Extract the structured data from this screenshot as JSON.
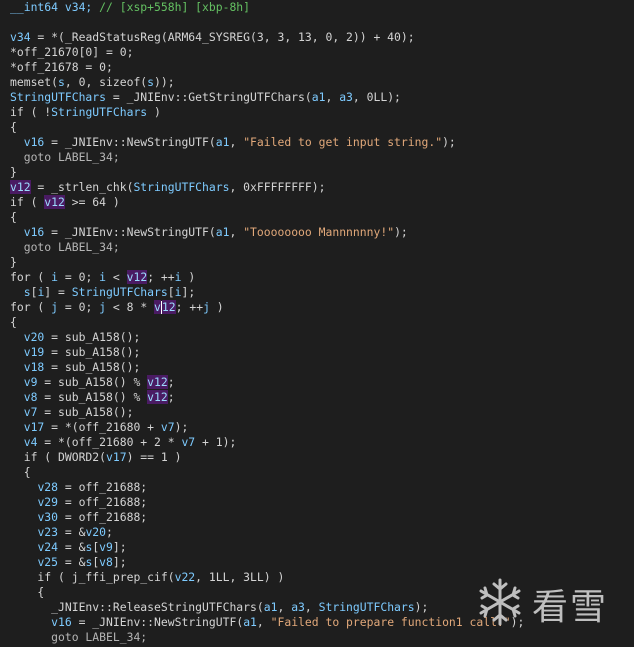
{
  "code_lines": [
    [
      {
        "t": "__int64 v34; ",
        "c": "var"
      },
      {
        "t": "// [xsp+558h] [xbp-8h]",
        "c": "cmt"
      }
    ],
    [],
    [
      {
        "t": "v34",
        "c": "var"
      },
      {
        "t": " = *(_ReadStatusReg(ARM64_SYSREG(3, 3, 13, 0, 2)) + 40);",
        "c": "white"
      }
    ],
    [
      {
        "t": "*off_21670[0] = 0;",
        "c": "white"
      }
    ],
    [
      {
        "t": "*off_21678 = 0;",
        "c": "white"
      }
    ],
    [
      {
        "t": "memset(",
        "c": "white"
      },
      {
        "t": "s",
        "c": "var"
      },
      {
        "t": ", 0, sizeof(",
        "c": "white"
      },
      {
        "t": "s",
        "c": "var"
      },
      {
        "t": "));",
        "c": "white"
      }
    ],
    [
      {
        "t": "StringUTFChars",
        "c": "var"
      },
      {
        "t": " = _JNIEnv::GetStringUTFChars(",
        "c": "white"
      },
      {
        "t": "a1",
        "c": "var"
      },
      {
        "t": ", ",
        "c": "white"
      },
      {
        "t": "a3",
        "c": "var"
      },
      {
        "t": ", 0LL);",
        "c": "white"
      }
    ],
    [
      {
        "t": "if ( !",
        "c": "white"
      },
      {
        "t": "StringUTFChars",
        "c": "var"
      },
      {
        "t": " )",
        "c": "white"
      }
    ],
    [
      {
        "t": "{",
        "c": "white"
      }
    ],
    [
      {
        "t": "  ",
        "c": "white"
      },
      {
        "t": "v16",
        "c": "var"
      },
      {
        "t": " = _JNIEnv::NewStringUTF(",
        "c": "white"
      },
      {
        "t": "a1",
        "c": "var"
      },
      {
        "t": ", ",
        "c": "white"
      },
      {
        "t": "\"Failed to get input string.\"",
        "c": "str"
      },
      {
        "t": ");",
        "c": "white"
      }
    ],
    [
      {
        "t": "  goto LABEL_34;",
        "c": "gray"
      }
    ],
    [
      {
        "t": "}",
        "c": "white"
      }
    ],
    [
      {
        "t": "v12",
        "c": "hl"
      },
      {
        "t": " = _strlen_chk(",
        "c": "white"
      },
      {
        "t": "StringUTFChars",
        "c": "var"
      },
      {
        "t": ", 0xFFFFFFFF);",
        "c": "white"
      }
    ],
    [
      {
        "t": "if ( ",
        "c": "white"
      },
      {
        "t": "v12",
        "c": "hl"
      },
      {
        "t": " >= 64 )",
        "c": "white"
      }
    ],
    [
      {
        "t": "{",
        "c": "white"
      }
    ],
    [
      {
        "t": "  ",
        "c": "white"
      },
      {
        "t": "v16",
        "c": "var"
      },
      {
        "t": " = _JNIEnv::NewStringUTF(",
        "c": "white"
      },
      {
        "t": "a1",
        "c": "var"
      },
      {
        "t": ", ",
        "c": "white"
      },
      {
        "t": "\"Toooooooo Mannnnnny!\"",
        "c": "str"
      },
      {
        "t": ");",
        "c": "white"
      }
    ],
    [
      {
        "t": "  goto LABEL_34;",
        "c": "gray"
      }
    ],
    [
      {
        "t": "}",
        "c": "white"
      }
    ],
    [
      {
        "t": "for ( ",
        "c": "white"
      },
      {
        "t": "i",
        "c": "var"
      },
      {
        "t": " = 0; ",
        "c": "white"
      },
      {
        "t": "i",
        "c": "var"
      },
      {
        "t": " < ",
        "c": "white"
      },
      {
        "t": "v12",
        "c": "hl"
      },
      {
        "t": "; ++",
        "c": "white"
      },
      {
        "t": "i",
        "c": "var"
      },
      {
        "t": " )",
        "c": "white"
      }
    ],
    [
      {
        "t": "  ",
        "c": "white"
      },
      {
        "t": "s",
        "c": "var"
      },
      {
        "t": "[",
        "c": "white"
      },
      {
        "t": "i",
        "c": "var"
      },
      {
        "t": "] = ",
        "c": "white"
      },
      {
        "t": "StringUTFChars",
        "c": "var"
      },
      {
        "t": "[",
        "c": "white"
      },
      {
        "t": "i",
        "c": "var"
      },
      {
        "t": "];",
        "c": "white"
      }
    ],
    [
      {
        "t": "for ( ",
        "c": "white"
      },
      {
        "t": "j",
        "c": "var"
      },
      {
        "t": " = 0; ",
        "c": "white"
      },
      {
        "t": "j",
        "c": "var"
      },
      {
        "t": " < 8 * ",
        "c": "white"
      },
      {
        "t": "v",
        "c": "hl"
      },
      {
        "t": "",
        "c": "cursor"
      },
      {
        "t": "12",
        "c": "hl"
      },
      {
        "t": "; ++",
        "c": "white"
      },
      {
        "t": "j",
        "c": "var"
      },
      {
        "t": " )",
        "c": "white"
      }
    ],
    [
      {
        "t": "{",
        "c": "white"
      }
    ],
    [
      {
        "t": "  ",
        "c": "white"
      },
      {
        "t": "v20",
        "c": "var"
      },
      {
        "t": " = sub_A158();",
        "c": "white"
      }
    ],
    [
      {
        "t": "  ",
        "c": "white"
      },
      {
        "t": "v19",
        "c": "var"
      },
      {
        "t": " = sub_A158();",
        "c": "white"
      }
    ],
    [
      {
        "t": "  ",
        "c": "white"
      },
      {
        "t": "v18",
        "c": "var"
      },
      {
        "t": " = sub_A158();",
        "c": "white"
      }
    ],
    [
      {
        "t": "  ",
        "c": "white"
      },
      {
        "t": "v9",
        "c": "var"
      },
      {
        "t": " = sub_A158() % ",
        "c": "white"
      },
      {
        "t": "v12",
        "c": "hl"
      },
      {
        "t": ";",
        "c": "white"
      }
    ],
    [
      {
        "t": "  ",
        "c": "white"
      },
      {
        "t": "v8",
        "c": "var"
      },
      {
        "t": " = sub_A158() % ",
        "c": "white"
      },
      {
        "t": "v12",
        "c": "hl"
      },
      {
        "t": ";",
        "c": "white"
      }
    ],
    [
      {
        "t": "  ",
        "c": "white"
      },
      {
        "t": "v7",
        "c": "var"
      },
      {
        "t": " = sub_A158();",
        "c": "white"
      }
    ],
    [
      {
        "t": "  ",
        "c": "white"
      },
      {
        "t": "v17",
        "c": "var"
      },
      {
        "t": " = *(off_21680 + ",
        "c": "white"
      },
      {
        "t": "v7",
        "c": "var"
      },
      {
        "t": ");",
        "c": "white"
      }
    ],
    [
      {
        "t": "  ",
        "c": "white"
      },
      {
        "t": "v4",
        "c": "var"
      },
      {
        "t": " = *(off_21680 + 2 * ",
        "c": "white"
      },
      {
        "t": "v7",
        "c": "var"
      },
      {
        "t": " + 1);",
        "c": "white"
      }
    ],
    [
      {
        "t": "  if ( DWORD2(",
        "c": "white"
      },
      {
        "t": "v17",
        "c": "var"
      },
      {
        "t": ") == 1 )",
        "c": "white"
      }
    ],
    [
      {
        "t": "  {",
        "c": "white"
      }
    ],
    [
      {
        "t": "    ",
        "c": "white"
      },
      {
        "t": "v28",
        "c": "var"
      },
      {
        "t": " = off_21688;",
        "c": "white"
      }
    ],
    [
      {
        "t": "    ",
        "c": "white"
      },
      {
        "t": "v29",
        "c": "var"
      },
      {
        "t": " = off_21688;",
        "c": "white"
      }
    ],
    [
      {
        "t": "    ",
        "c": "white"
      },
      {
        "t": "v30",
        "c": "var"
      },
      {
        "t": " = off_21688;",
        "c": "white"
      }
    ],
    [
      {
        "t": "    ",
        "c": "white"
      },
      {
        "t": "v23",
        "c": "var"
      },
      {
        "t": " = &",
        "c": "white"
      },
      {
        "t": "v20",
        "c": "var"
      },
      {
        "t": ";",
        "c": "white"
      }
    ],
    [
      {
        "t": "    ",
        "c": "white"
      },
      {
        "t": "v24",
        "c": "var"
      },
      {
        "t": " = &",
        "c": "white"
      },
      {
        "t": "s",
        "c": "var"
      },
      {
        "t": "[",
        "c": "white"
      },
      {
        "t": "v9",
        "c": "var"
      },
      {
        "t": "];",
        "c": "white"
      }
    ],
    [
      {
        "t": "    ",
        "c": "white"
      },
      {
        "t": "v25",
        "c": "var"
      },
      {
        "t": " = &",
        "c": "white"
      },
      {
        "t": "s",
        "c": "var"
      },
      {
        "t": "[",
        "c": "white"
      },
      {
        "t": "v8",
        "c": "var"
      },
      {
        "t": "];",
        "c": "white"
      }
    ],
    [
      {
        "t": "    if ( j_ffi_prep_cif(",
        "c": "white"
      },
      {
        "t": "v22",
        "c": "var"
      },
      {
        "t": ", 1LL, 3LL) )",
        "c": "white"
      }
    ],
    [
      {
        "t": "    {",
        "c": "white"
      }
    ],
    [
      {
        "t": "      _JNIEnv::ReleaseStringUTFChars(",
        "c": "white"
      },
      {
        "t": "a1",
        "c": "var"
      },
      {
        "t": ", ",
        "c": "white"
      },
      {
        "t": "a3",
        "c": "var"
      },
      {
        "t": ", ",
        "c": "white"
      },
      {
        "t": "StringUTFChars",
        "c": "var"
      },
      {
        "t": ");",
        "c": "white"
      }
    ],
    [
      {
        "t": "      ",
        "c": "white"
      },
      {
        "t": "v16",
        "c": "var"
      },
      {
        "t": " = _JNIEnv::NewStringUTF(",
        "c": "white"
      },
      {
        "t": "a1",
        "c": "var"
      },
      {
        "t": ", ",
        "c": "white"
      },
      {
        "t": "\"Failed to prepare function1 call.\"",
        "c": "str"
      },
      {
        "t": ");",
        "c": "white"
      }
    ],
    [
      {
        "t": "      goto LABEL_34;",
        "c": "gray"
      }
    ]
  ],
  "watermark": {
    "logo_text": "看雪",
    "icon": "snowflake-icon"
  },
  "colors": {
    "background": "#1e1e1e",
    "identifier": "#7ecbff",
    "text": "#d4d4d4",
    "string": "#e1a87a",
    "comment": "#64c062",
    "highlight_bg": "#4a1b63"
  }
}
